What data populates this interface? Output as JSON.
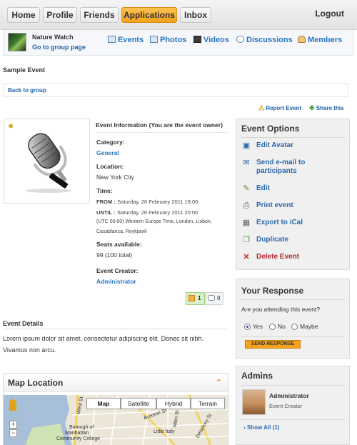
{
  "nav": {
    "tabs": [
      {
        "label": "Home"
      },
      {
        "label": "Profile"
      },
      {
        "label": "Friends"
      },
      {
        "label": "Applications",
        "active": true
      },
      {
        "label": "Inbox"
      }
    ],
    "logout": "Logout"
  },
  "group": {
    "name": "Nature Watch",
    "link": "Go to group page",
    "tabs": [
      {
        "label": "Events",
        "icon": "calendar-icon"
      },
      {
        "label": "Photos",
        "icon": "photo-icon"
      },
      {
        "label": "Videos",
        "icon": "video-icon"
      },
      {
        "label": "Discussions",
        "icon": "discussion-icon"
      },
      {
        "label": "Members",
        "icon": "members-icon"
      }
    ]
  },
  "page": {
    "title": "Sample Event",
    "back_link": "Back to group",
    "report": "Report Event",
    "share": "Share this"
  },
  "event": {
    "heading": "Event Information (You are the event owner)",
    "category_label": "Category:",
    "category": "General",
    "location_label": "Location:",
    "location": "New York City",
    "time_label": "Time:",
    "from_label": "FROM :",
    "from": "Saturday, 26 February 2011 18:00",
    "until_label": "UNTIL :",
    "until": "Saturday, 26 February 2011 20:00",
    "timezone_line1": "(UTC 00:00) Western Europe Time, London, Lisbon,",
    "timezone_line2": "Casablanca, Reykjavik",
    "seats_label": "Seats available:",
    "seats": "99 (100 total)",
    "creator_label": "Event Creator:",
    "creator": "Administrator",
    "attending_count": "1",
    "comments_count": "0"
  },
  "details": {
    "title": "Event Details",
    "line1": "Lorem ipsum dolor sit amet, consectetur adipiscing elit. Donec sit nibh.",
    "line2": "Vivamus non arcu."
  },
  "map": {
    "title": "Map Location",
    "types": [
      "Map",
      "Satellite",
      "Hybrid",
      "Terrain"
    ],
    "selected": "Map",
    "labels": {
      "street1": "West St",
      "street2": "Broome St",
      "street3": "Delancey St",
      "street4": "Allen St",
      "area1": "Little Italy",
      "area2": "Borough of",
      "area3": "Manhattan",
      "area4": "Community College"
    }
  },
  "options": {
    "title": "Event Options",
    "items": [
      {
        "label": "Edit Avatar",
        "icon": "edit-avatar-icon"
      },
      {
        "label": "Send e-mail to",
        "label2": "participants",
        "icon": "email-icon"
      },
      {
        "label": "Edit",
        "icon": "pencil-icon"
      },
      {
        "label": "Print event",
        "icon": "print-icon"
      },
      {
        "label": "Export to iCal",
        "icon": "calendar-export-icon"
      },
      {
        "label": "Duplicate",
        "icon": "duplicate-icon"
      },
      {
        "label": "Delete Event",
        "icon": "delete-icon"
      }
    ]
  },
  "response": {
    "title": "Your Response",
    "question": "Are you attending this event?",
    "options": [
      "Yes",
      "No",
      "Maybe"
    ],
    "selected": "Yes",
    "button": "SEND RESPONSE"
  },
  "admins": {
    "title": "Admins",
    "name": "Administrator",
    "role": "Event Creator",
    "show_all": "Show All (1)"
  },
  "colors": {
    "accent": "#f4a21d",
    "link": "#2a76c4",
    "danger": "#b0282e"
  }
}
